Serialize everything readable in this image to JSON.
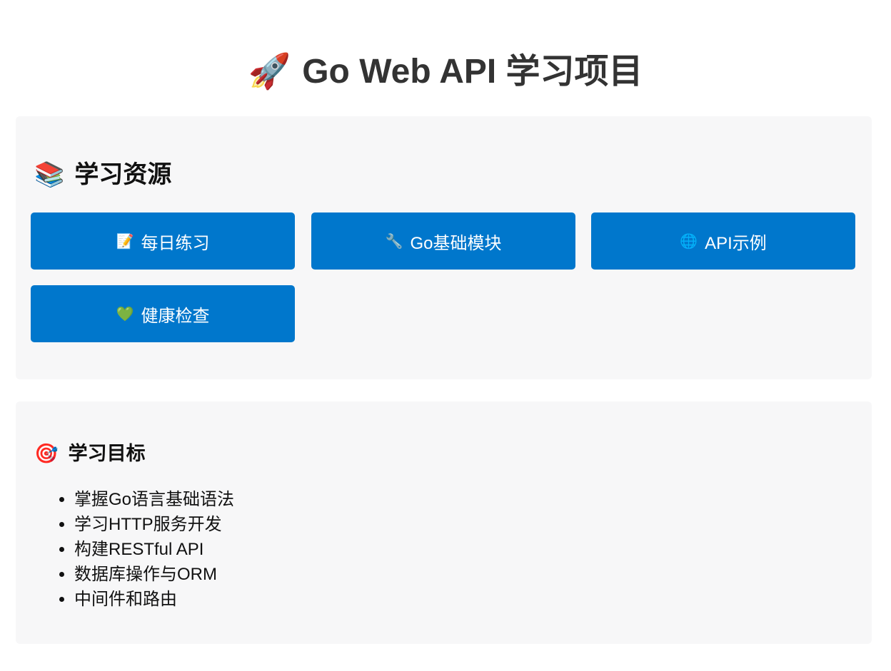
{
  "header": {
    "icon": "rocket-icon",
    "icon_glyph": "🚀",
    "title": "Go Web API 学习项目"
  },
  "resources": {
    "icon": "books-icon",
    "icon_glyph": "📚",
    "title": "学习资源",
    "buttons": [
      {
        "icon": "memo-icon",
        "icon_glyph": "📝",
        "label": "每日练习"
      },
      {
        "icon": "wrench-icon",
        "icon_glyph": "🔧",
        "label": "Go基础模块"
      },
      {
        "icon": "globe-icon",
        "icon_glyph": "🌐",
        "label": "API示例"
      },
      {
        "icon": "green-heart-icon",
        "icon_glyph": "💚",
        "label": "健康检查"
      }
    ],
    "button_color": "#0077cc"
  },
  "goals": {
    "icon": "target-icon",
    "icon_glyph": "🎯",
    "title": "学习目标",
    "items": [
      "掌握Go语言基础语法",
      "学习HTTP服务开发",
      "构建RESTful API",
      "数据库操作与ORM",
      "中间件和路由"
    ]
  }
}
